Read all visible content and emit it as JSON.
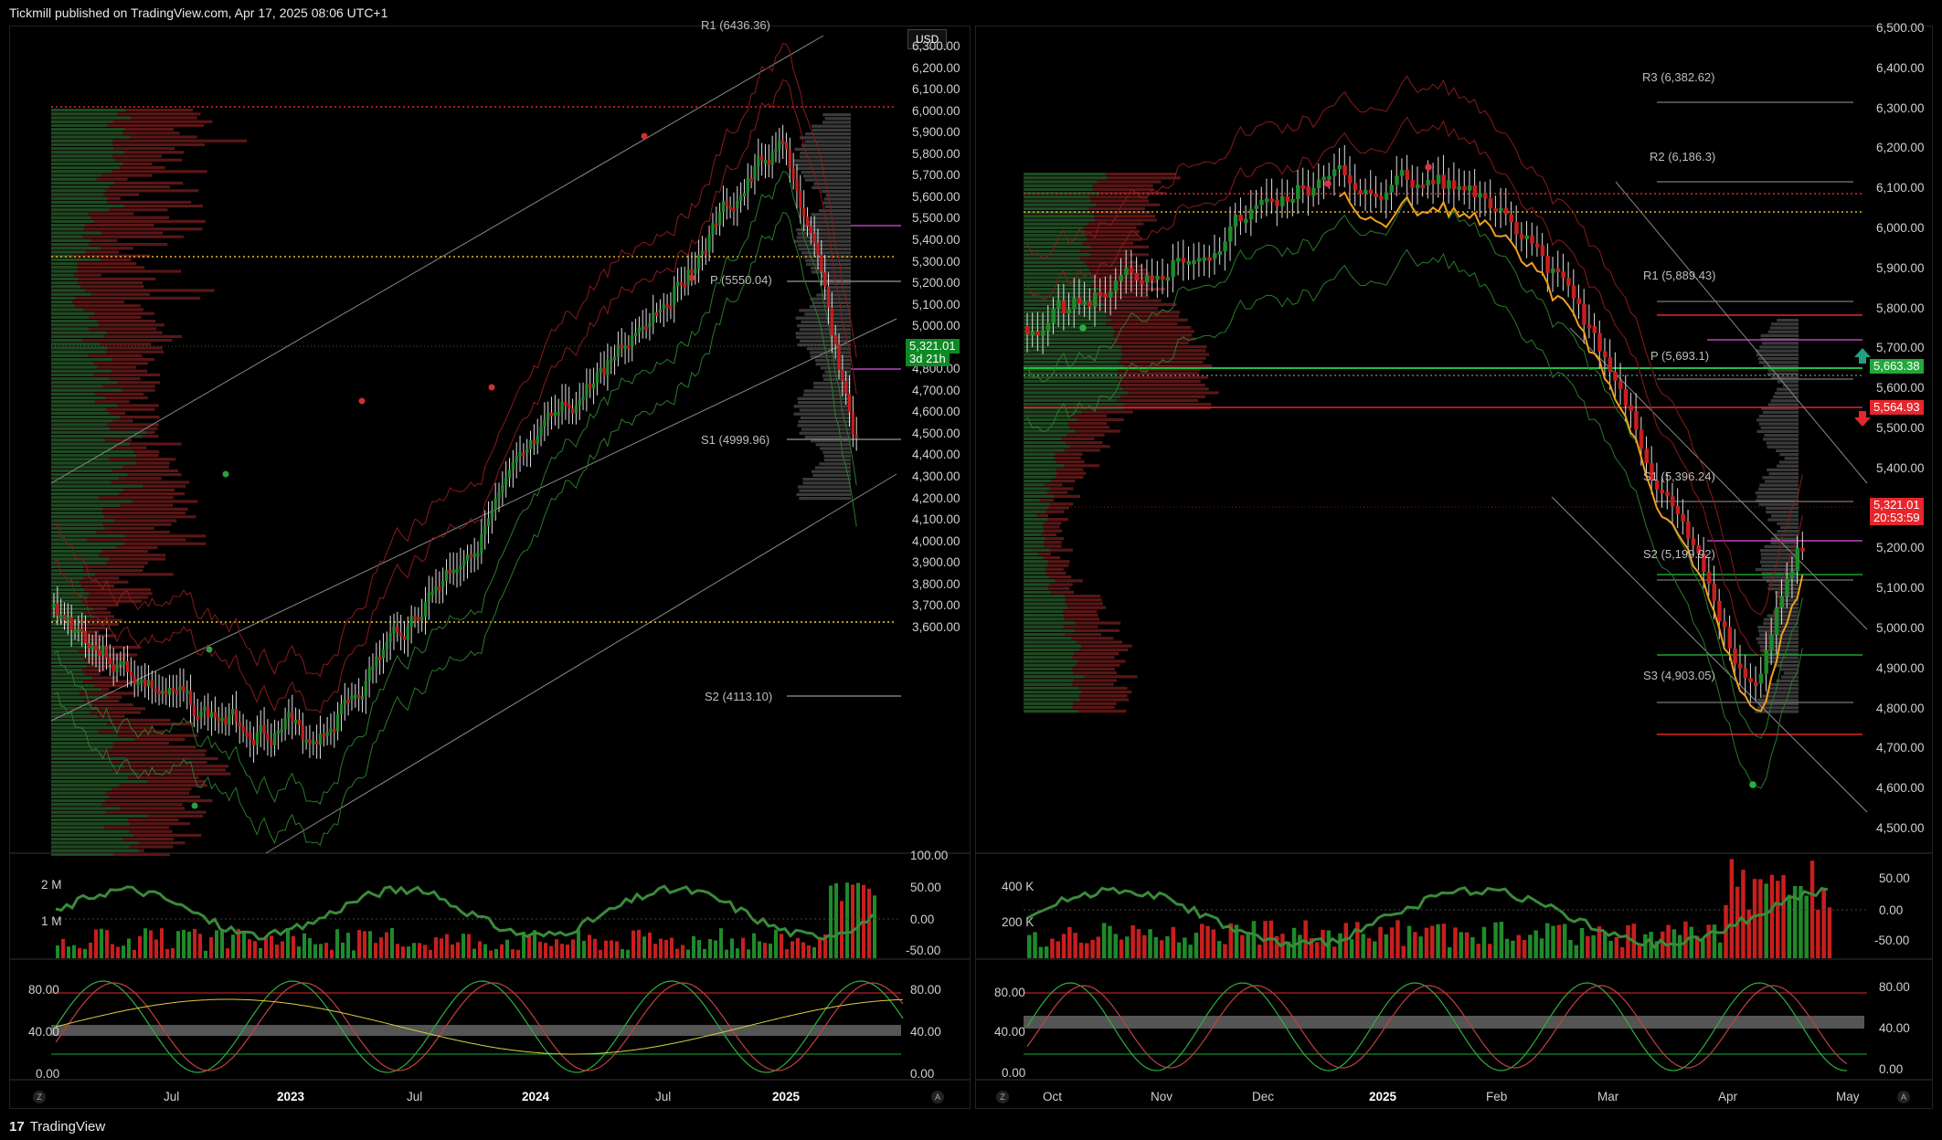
{
  "header": {
    "text": "Tickmill published on TradingView.com, Apr 17, 2025 08:06 UTC+1"
  },
  "footer": {
    "brand": "TradingView",
    "logo": "tv-logo-icon"
  },
  "left": {
    "currency": "USD",
    "price_axis": [
      "6,300.00",
      "6,200.00",
      "6,100.00",
      "6,000.00",
      "5,900.00",
      "5,800.00",
      "5,700.00",
      "5,600.00",
      "5,500.00",
      "5,400.00",
      "5,300.00",
      "5,200.00",
      "5,100.00",
      "5,000.00",
      "4,900.00",
      "4,800.00",
      "4,700.00",
      "4,600.00",
      "4,500.00",
      "4,400.00",
      "4,300.00",
      "4,200.00",
      "4,100.00",
      "4,000.00",
      "3,900.00",
      "3,800.00",
      "3,700.00",
      "3,600.00"
    ],
    "price_tag": "5,321.01",
    "countdown": "3d 21h",
    "pivots": {
      "top": "R1 (6436.36)",
      "p": "P (5550.04)",
      "s1": "S1 (4999.96)",
      "s2": "S2 (4113.10)"
    },
    "volume_axis": [
      "2 M",
      "1 M"
    ],
    "osc1_axis": [
      "100.00",
      "50.00",
      "0.00",
      "-50.00"
    ],
    "osc2_axis_left": [
      "80.00",
      "40.00",
      "0.00"
    ],
    "osc2_axis_right": [
      "80.00",
      "40.00",
      "0.00"
    ],
    "time_axis": [
      {
        "label": "Jul",
        "bold": false
      },
      {
        "label": "2023",
        "bold": true
      },
      {
        "label": "Jul",
        "bold": false
      },
      {
        "label": "2024",
        "bold": true
      },
      {
        "label": "Jul",
        "bold": false
      },
      {
        "label": "2025",
        "bold": true
      }
    ],
    "corner_left": "Z",
    "corner_right": "A"
  },
  "right": {
    "price_axis": [
      "6,500.00",
      "6,400.00",
      "6,300.00",
      "6,200.00",
      "6,100.00",
      "6,000.00",
      "5,900.00",
      "5,800.00",
      "5,700.00",
      "5,600.00",
      "5,500.00",
      "5,400.00",
      "5,300.00",
      "5,200.00",
      "5,100.00",
      "5,000.00",
      "4,900.00",
      "4,800.00",
      "4,700.00",
      "4,600.00",
      "4,500.00"
    ],
    "top_label": "6,500.00",
    "tag_green": "5,663.38",
    "tag_red_top": "5,564.93",
    "price_tag": "5,321.01",
    "countdown": "20:53:59",
    "pivots": {
      "r3": "R3 (6,382.62)",
      "r2": "R2 (6,186.3)",
      "r1": "R1 (5,889.43)",
      "p": "P (5,693.1)",
      "s1": "S1 (5,396.24)",
      "s2": "S2 (5,199.92)",
      "s3": "S3 (4,903.05)"
    },
    "volume_axis": [
      "400 K",
      "200 K"
    ],
    "osc1_axis": [
      "50.00",
      "0.00",
      "-50.00"
    ],
    "osc2_axis_left": [
      "80.00",
      "40.00",
      "0.00"
    ],
    "osc2_axis_right": [
      "80.00",
      "40.00",
      "0.00"
    ],
    "time_axis": [
      {
        "label": "Oct",
        "bold": false
      },
      {
        "label": "Nov",
        "bold": false
      },
      {
        "label": "Dec",
        "bold": false
      },
      {
        "label": "2025",
        "bold": true
      },
      {
        "label": "Feb",
        "bold": false
      },
      {
        "label": "Mar",
        "bold": false
      },
      {
        "label": "Apr",
        "bold": false
      },
      {
        "label": "May",
        "bold": false
      }
    ],
    "corner_left": "Z",
    "corner_right": "A"
  },
  "colors": {
    "up": "#1f8a2a",
    "down": "#c81e1e",
    "profile_up": "#1d4a22",
    "profile_down": "#5a1616",
    "accent_green": "#22a83a",
    "accent_red": "#e5262c"
  }
}
